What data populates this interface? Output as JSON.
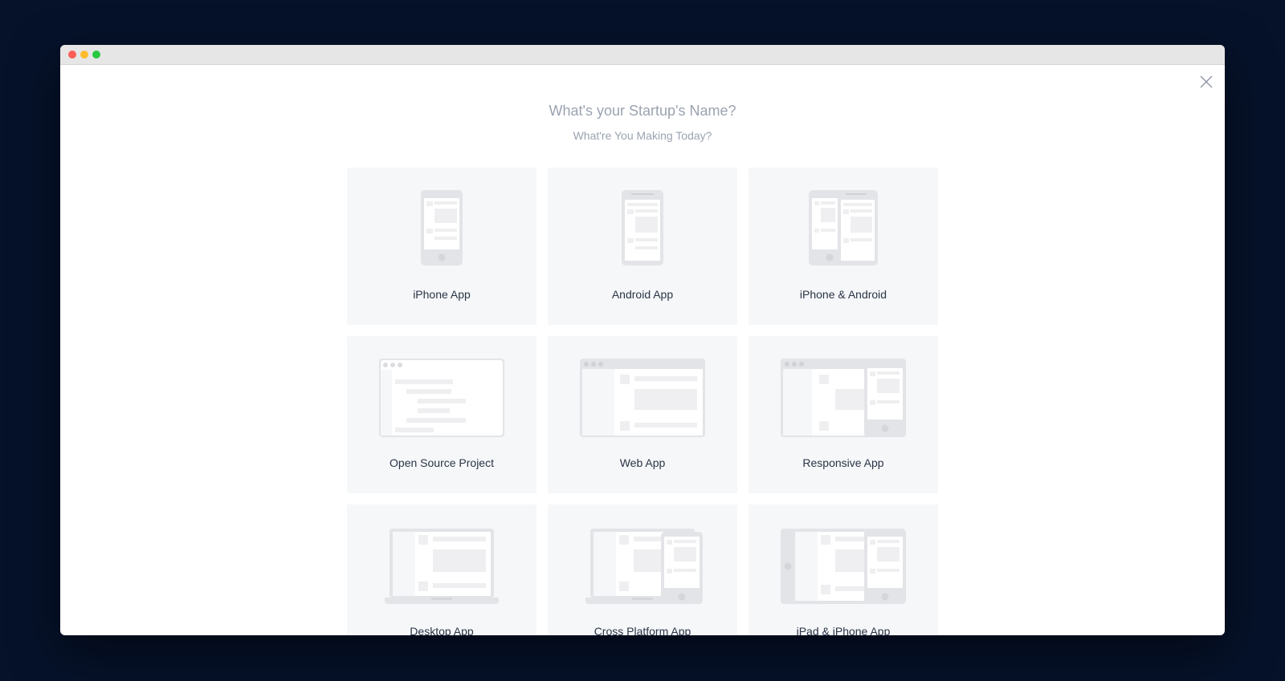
{
  "window": {
    "title": ""
  },
  "header": {
    "title": "What's your Startup's Name?",
    "subtitle": "What're You Making Today?"
  },
  "options": [
    {
      "label": "iPhone App",
      "icon": "iphone-icon"
    },
    {
      "label": "Android App",
      "icon": "android-phone-icon"
    },
    {
      "label": "iPhone & Android",
      "icon": "iphone-android-icon"
    },
    {
      "label": "Open Source Project",
      "icon": "open-source-browser-icon"
    },
    {
      "label": "Web App",
      "icon": "web-browser-icon"
    },
    {
      "label": "Responsive App",
      "icon": "responsive-icon"
    },
    {
      "label": "Desktop App",
      "icon": "laptop-icon"
    },
    {
      "label": "Cross Platform App",
      "icon": "cross-platform-icon"
    },
    {
      "label": "iPad & iPhone App",
      "icon": "ipad-iphone-icon"
    }
  ],
  "colors": {
    "background": "#06122a",
    "card": "#f6f7f9",
    "illustration": "#e3e4e7",
    "text": "#2a3445",
    "muted": "#9ba3b1"
  }
}
